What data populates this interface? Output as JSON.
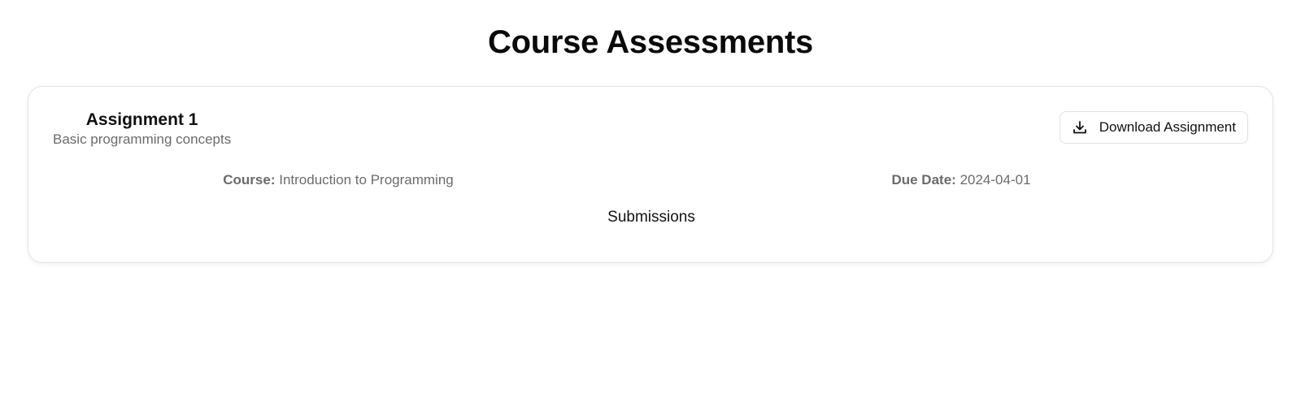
{
  "page": {
    "title": "Course Assessments"
  },
  "assignment": {
    "title": "Assignment 1",
    "description": "Basic programming concepts",
    "download_label": "Download Assignment",
    "download_icon": "download-icon",
    "course_label": "Course:",
    "course_value": "Introduction to Programming",
    "due_label": "Due Date:",
    "due_value": "2024-04-01",
    "submissions_heading": "Submissions"
  }
}
